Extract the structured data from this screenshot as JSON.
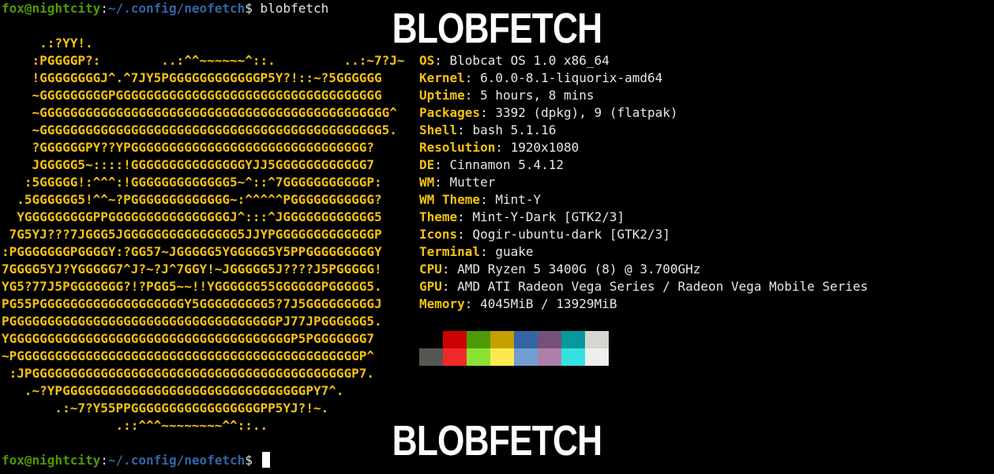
{
  "terminal": {
    "prompt": {
      "user_host": "fox@nightcity",
      "sep": ":",
      "path": "~/.config/neofetch",
      "symbol": "$ "
    },
    "command": "blobfetch"
  },
  "ascii_art": "     .:?YY!.\n    :PGGGGP?:        ..:^^~~~~~~^::.         ..:~7?J~\n    !GGGGGGGGJ^.^7JY5PGGGGGGGGGGGGP5Y?!::~?5GGGGGG\n    ~GGGGGGGGGPGGGGGGGGGGGGGGGGGGGGGGGGGGGGGGGGGGG\n    ~GGGGGGGGGGGGGGGGGGGGGGGGGGGGGGGGGGGGGGGGGGGGGG^\n    ~GGGGGGGGGGGGGGGGGGGGGGGGGGGGGGGGGGGGGGGGGGGGG5.\n    ?GGGGGGPY??YPGGGGGGGGGGGGGGGGGGGGGGGGGGGGGGG?\n    JGGGGG5~::::!GGGGGGGGGGGGGGGYJJ5GGGGGGGGGGGG7\n   :5GGGGG!:^^^:!GGGGGGGGGGGGG5~^::^7GGGGGGGGGGGP:\n  .5GGGGGG5!^^~?PGGGGGGGGGGGGG~:^^^^^PGGGGGGGGGGG?\n  YGGGGGGGGGPPGGGGGGGGGGGGGGGGJ^:::^JGGGGGGGGGGGG5\n 7G5YJ???7JGGG5JGGGGGGGGGGGGGGG5JJYPGGGGGGGGGGGGGP\n:PGGGGGGGPGGGGY:?GG57~JGGGGG5YGGGGG5Y5PPGGGGGGGGGY\n7GGGG5YJ?YGGGGG7^J?~?J^7GGY!~JGGGGG5J????J5PGGGGG!\nYG5?77J5PGGGGGGG?!?PGG5~~!!YGGGGGG55GGGGGGPGGGGG5.\nPG55PGGGGGGGGGGGGGGGGGGGY5GGGGGGGGG5?7J5GGGGGGGGGJ\nPGGGGGGGGGGGGGGGGGGGGGGGGGGGGGGGGGGGPJ77JPGGGGGG5.\nYGGGGGGGGGGGGGGGGGGGGGGGGGGGGGGGGGGGGGP5PGGGGGGG7\n~PGGGGGGGGGGGGGGGGGGGGGGGGGGGGGGGGGGGGGGGGGGGGGP^\n :JPGGGGGGGGGGGGGGGGGGGGGGGGGGGGGGGGGGGGGGGGGGP7.\n   .~?YPGGGGGGGGGGGGGGGGGGGGGGGGGGGGGGGGPY7^.\n       .:~7?Y55PPGGGGGGGGGGGGGGGGGPP5YJ?!~.\n               .::^^^~~~~~~~~^^::..",
  "info": [
    {
      "key": "OS",
      "value": "Blobcat OS 1.0 x86_64"
    },
    {
      "key": "Kernel",
      "value": "6.0.0-8.1-liquorix-amd64"
    },
    {
      "key": "Uptime",
      "value": "5 hours, 8 mins"
    },
    {
      "key": "Packages",
      "value": "3392 (dpkg), 9 (flatpak)"
    },
    {
      "key": "Shell",
      "value": "bash 5.1.16"
    },
    {
      "key": "Resolution",
      "value": "1920x1080"
    },
    {
      "key": "DE",
      "value": "Cinnamon 5.4.12"
    },
    {
      "key": "WM",
      "value": "Mutter"
    },
    {
      "key": "WM Theme",
      "value": "Mint-Y"
    },
    {
      "key": "Theme",
      "value": "Mint-Y-Dark [GTK2/3]"
    },
    {
      "key": "Icons",
      "value": "Qogir-ubuntu-dark [GTK2/3]"
    },
    {
      "key": "Terminal",
      "value": "guake"
    },
    {
      "key": "CPU",
      "value": "AMD Ryzen 5 3400G (8) @ 3.700GHz"
    },
    {
      "key": "GPU",
      "value": "AMD ATI Radeon Vega Series / Radeon Vega Mobile Series"
    },
    {
      "key": "Memory",
      "value": "4045MiB / 13929MiB"
    }
  ],
  "palette": [
    "#000000",
    "#cc0000",
    "#4e9a06",
    "#c4a000",
    "#3465a4",
    "#75507b",
    "#06989a",
    "#d3d7cf",
    "#555753",
    "#ef2929",
    "#8ae234",
    "#fce94f",
    "#729fcf",
    "#ad7fa8",
    "#34e2e2",
    "#eeeeec"
  ],
  "colors": {
    "accent_yellow": "#f5c211",
    "prompt_green": "#4e9a06",
    "prompt_blue": "#3465a4"
  },
  "captions": {
    "top": "BLOBFETCH",
    "bottom": "BLOBFETCH"
  }
}
